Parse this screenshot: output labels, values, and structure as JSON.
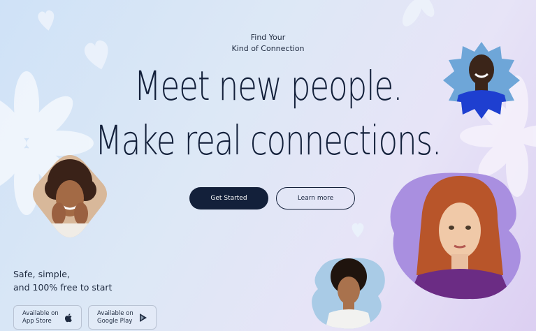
{
  "hero": {
    "eyebrow_line1": "Find Your",
    "eyebrow_line2": "Kind of Connection",
    "headline_line1": "Meet new people.",
    "headline_line2": "Make real connections."
  },
  "cta": {
    "primary_label": "Get Started",
    "secondary_label": "Learn more"
  },
  "tagline": {
    "line1": "Safe, simple,",
    "line2": "and 100% free to start"
  },
  "stores": [
    {
      "line1": "Available on",
      "line2": "App Store",
      "icon": "apple-icon"
    },
    {
      "line1": "Available on",
      "line2": "Google Play",
      "icon": "play-icon"
    }
  ],
  "colors": {
    "primary": "#13203a",
    "accent_purple": "#a98fe0",
    "accent_blue": "#1e3fd0"
  }
}
